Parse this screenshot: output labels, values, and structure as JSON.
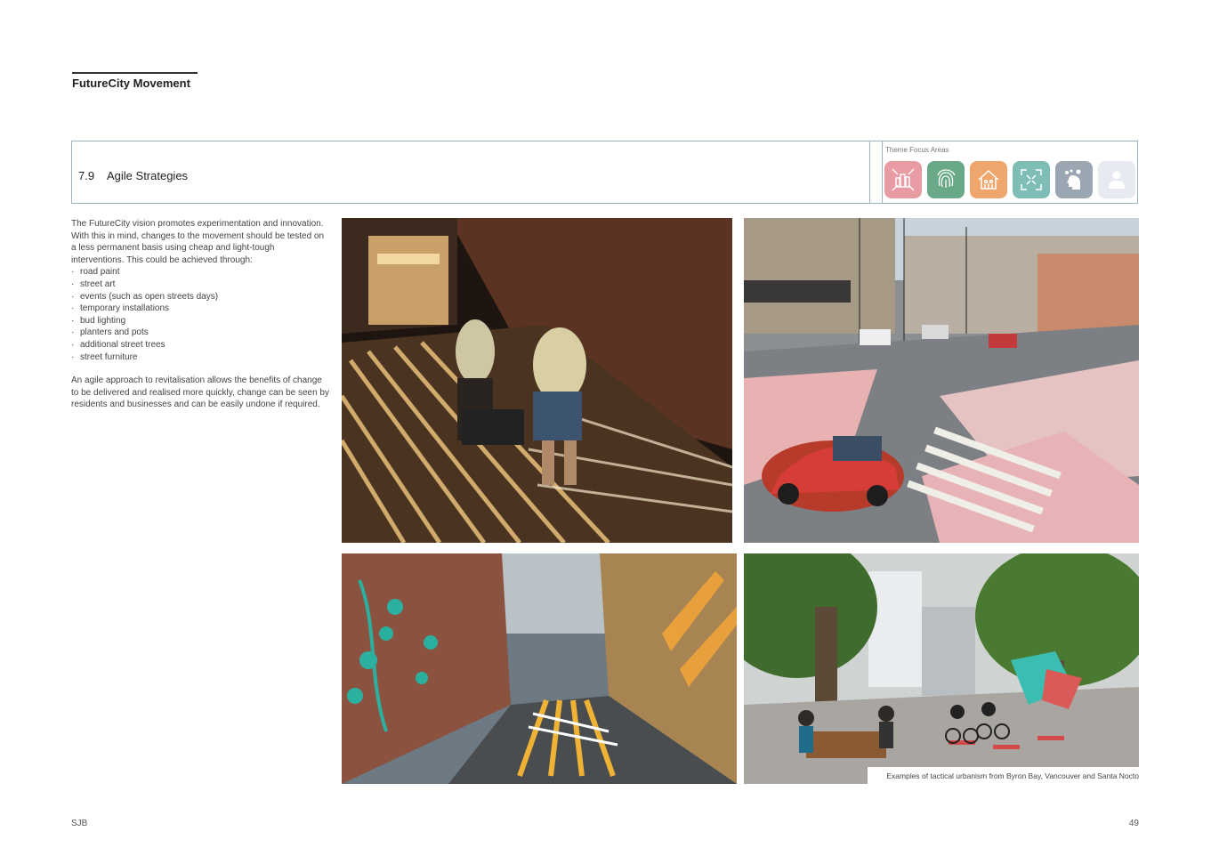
{
  "header": {
    "title": "FutureCity Movement"
  },
  "section": {
    "number": "7.9",
    "title": "Agile Strategies"
  },
  "themes": {
    "label": "Theme Focus Areas",
    "icons": [
      {
        "name": "city-icon",
        "color": "#e89ba3"
      },
      {
        "name": "fingerprint-icon",
        "color": "#6aa987"
      },
      {
        "name": "community-house-icon",
        "color": "#eea66d"
      },
      {
        "name": "expand-frame-icon",
        "color": "#7dbdb6"
      },
      {
        "name": "head-ideas-icon",
        "color": "#9aa7b3"
      },
      {
        "name": "person-icon",
        "color": "#e8eaf2"
      }
    ]
  },
  "intro": {
    "paragraph1": "The FutureCity vision promotes experimentation and innovation. With this in mind, changes to the movement should be tested on a less permanent basis using cheap and light-tough interventions. This could be achieved through:",
    "list": [
      "road paint",
      "street art",
      "events (such as open streets days)",
      "temporary installations",
      "bud lighting",
      "planters and pots",
      "additional street trees",
      "street furniture"
    ],
    "paragraph2": "An agile approach to revitalisation allows the benefits of change to be delivered and realised more quickly, change can be seen by residents and businesses and can be easily undone if required."
  },
  "caption": "Examples of tactical urbanism from Byron Bay, Vancouver and Santa Nocto",
  "footer": {
    "brand": "SJB",
    "page": "49"
  }
}
